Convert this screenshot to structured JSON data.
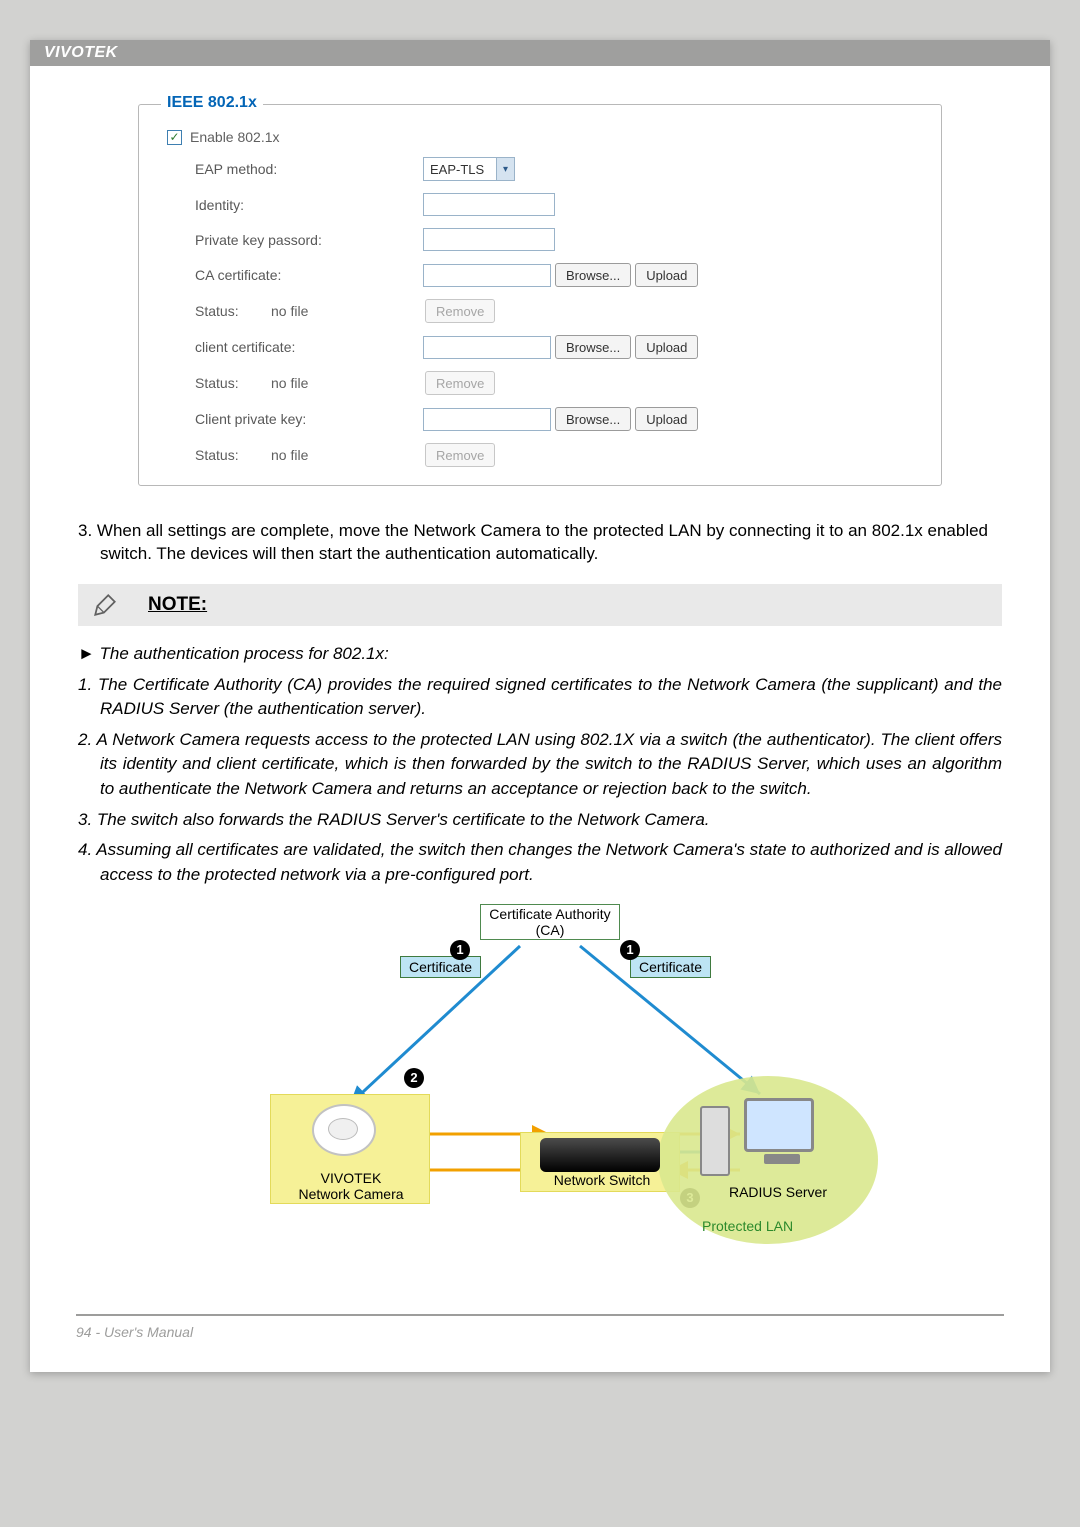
{
  "header": {
    "brand": "VIVOTEK"
  },
  "panel": {
    "legend": "IEEE 802.1x",
    "enable_label": "Enable 802.1x",
    "eap_label": "EAP method:",
    "eap_value": "EAP-TLS",
    "identity_label": "Identity:",
    "pk_password_label": "Private key passord:",
    "ca_cert_label": "CA certificate:",
    "client_cert_label": "client certificate:",
    "client_pk_label": "Client private key:",
    "status_label": "Status:",
    "status_value": "no file",
    "browse_label": "Browse...",
    "upload_label": "Upload",
    "remove_label": "Remove"
  },
  "instruction3": "3. When all settings are complete, move the Network Camera to the protected LAN by connecting it to an 802.1x enabled switch. The devices will then start the authentication automatically.",
  "note": {
    "heading": "NOTE:"
  },
  "auth_process": {
    "intro": "► The authentication process for 802.1x:",
    "p1": "1. The Certificate Authority (CA) provides the required signed certificates to the Network Camera (the supplicant) and the RADIUS Server (the authentication server).",
    "p2": "2. A Network Camera requests access to the protected LAN using 802.1X via a switch (the authenticator). The client offers its identity and client certificate, which is then forwarded by the switch to the RADIUS Server, which uses an algorithm to authenticate the Network Camera and returns an acceptance or rejection back to the switch.",
    "p3": "3. The switch also forwards the RADIUS Server's certificate to the Network Camera.",
    "p4": "4. Assuming all certificates are validated, the switch then changes the Network Camera's state to authorized and is allowed access to the protected network via a pre-configured port."
  },
  "diagram": {
    "ca_label": "Certificate Authority\n(CA)",
    "cert_label": "Certificate",
    "camera_label": "VIVOTEK\nNetwork Camera",
    "switch_label": "Network Switch",
    "radius_label": "RADIUS Server",
    "lan_label": "Protected LAN"
  },
  "footer": {
    "text": "94 - User's Manual"
  }
}
